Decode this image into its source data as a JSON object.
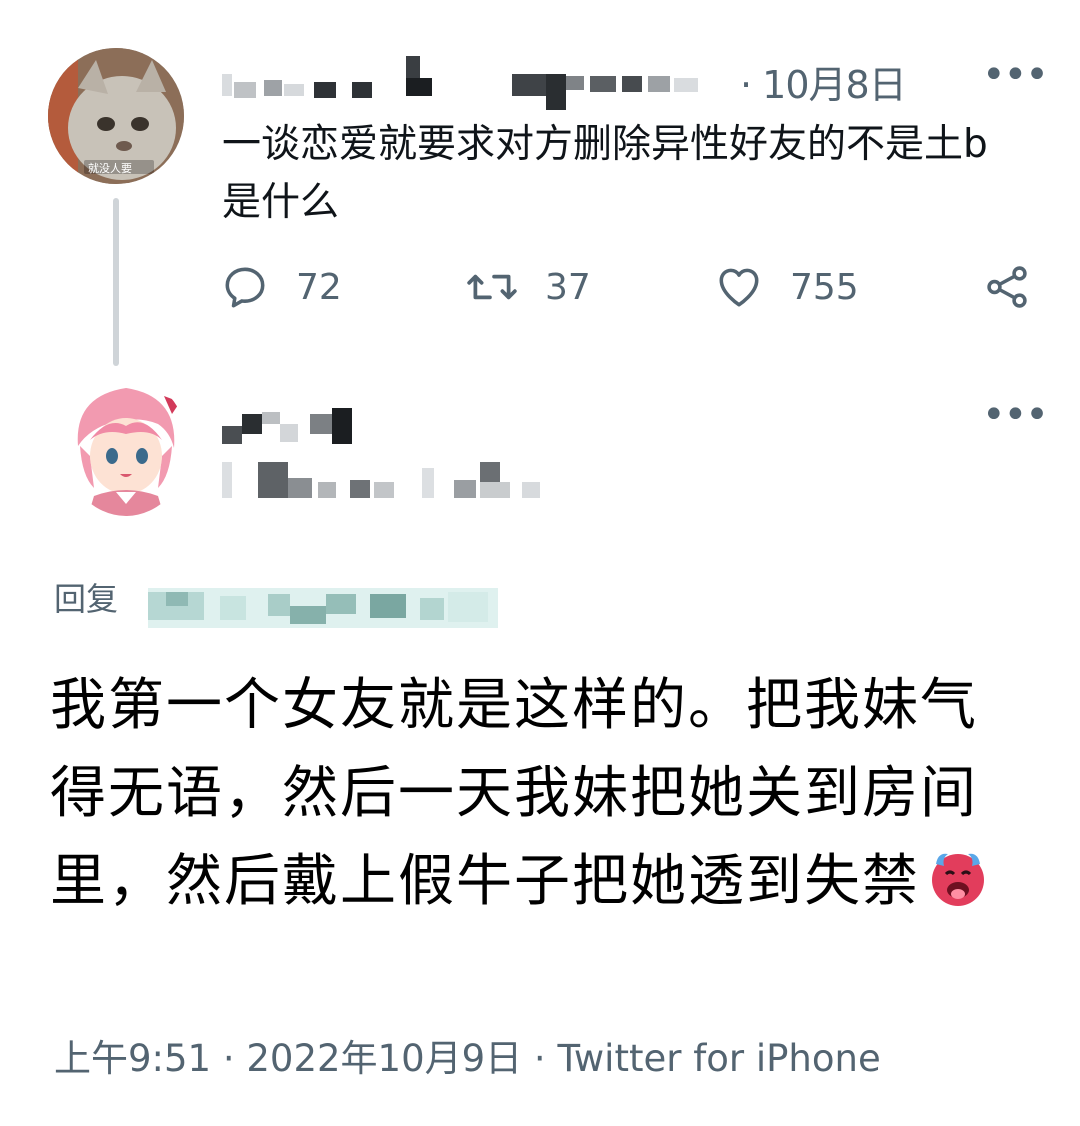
{
  "parent_tweet": {
    "timestamp": "· 10月8日",
    "text": "一谈恋爱就要求对方删除异性好友的不是土b是什么",
    "avatar_caption": "就没人要",
    "actions": {
      "reply_count": "72",
      "retweet_count": "37",
      "like_count": "755"
    }
  },
  "reply_tweet": {
    "reply_to_label": "回复",
    "text": "我第一个女友就是这样的。把我妹气得无语，然后一天我妹把她关到房间里，然后戴上假牛子把她透到失禁",
    "emoji": "hot-face-emoji",
    "footer": "上午9:51 · 2022年10月9日 · Twitter for iPhone"
  },
  "colors": {
    "text_primary": "#0f1419",
    "text_secondary": "#536471",
    "thread_line": "#cfd4d8"
  },
  "icons": [
    "reply-icon",
    "retweet-icon",
    "like-icon",
    "share-icon",
    "more-icon"
  ]
}
